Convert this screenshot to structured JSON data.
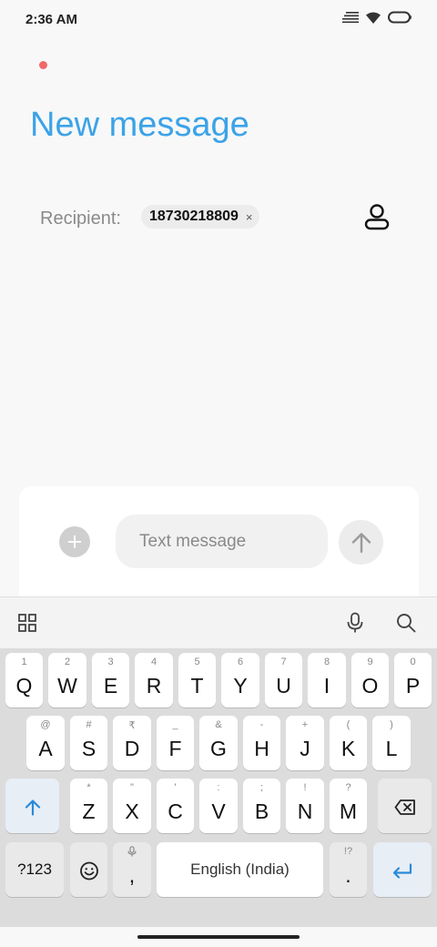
{
  "status_bar": {
    "time": "2:36 AM"
  },
  "header": {
    "title": "New message"
  },
  "recipient": {
    "label": "Recipient:",
    "chip_number": "18730218809",
    "chip_close": "×"
  },
  "compose": {
    "placeholder": "Text message"
  },
  "keyboard": {
    "row1": [
      {
        "main": "Q",
        "hint": "1"
      },
      {
        "main": "W",
        "hint": "2"
      },
      {
        "main": "E",
        "hint": "3"
      },
      {
        "main": "R",
        "hint": "4"
      },
      {
        "main": "T",
        "hint": "5"
      },
      {
        "main": "Y",
        "hint": "6"
      },
      {
        "main": "U",
        "hint": "7"
      },
      {
        "main": "I",
        "hint": "8"
      },
      {
        "main": "O",
        "hint": "9"
      },
      {
        "main": "P",
        "hint": "0"
      }
    ],
    "row2": [
      {
        "main": "A",
        "hint": "@"
      },
      {
        "main": "S",
        "hint": "#"
      },
      {
        "main": "D",
        "hint": "₹"
      },
      {
        "main": "F",
        "hint": "_"
      },
      {
        "main": "G",
        "hint": "&"
      },
      {
        "main": "H",
        "hint": "-"
      },
      {
        "main": "J",
        "hint": "+"
      },
      {
        "main": "K",
        "hint": "("
      },
      {
        "main": "L",
        "hint": ")"
      }
    ],
    "row3": [
      {
        "main": "Z",
        "hint": "*"
      },
      {
        "main": "X",
        "hint": "\""
      },
      {
        "main": "C",
        "hint": "'"
      },
      {
        "main": "V",
        "hint": ":"
      },
      {
        "main": "B",
        "hint": ";"
      },
      {
        "main": "N",
        "hint": "!"
      },
      {
        "main": "M",
        "hint": "?"
      }
    ],
    "symbols_label": "?123",
    "comma": {
      "main": ",",
      "hint": "🎤"
    },
    "space_label": "English (India)",
    "period": {
      "main": ".",
      "hint": "!?"
    }
  }
}
